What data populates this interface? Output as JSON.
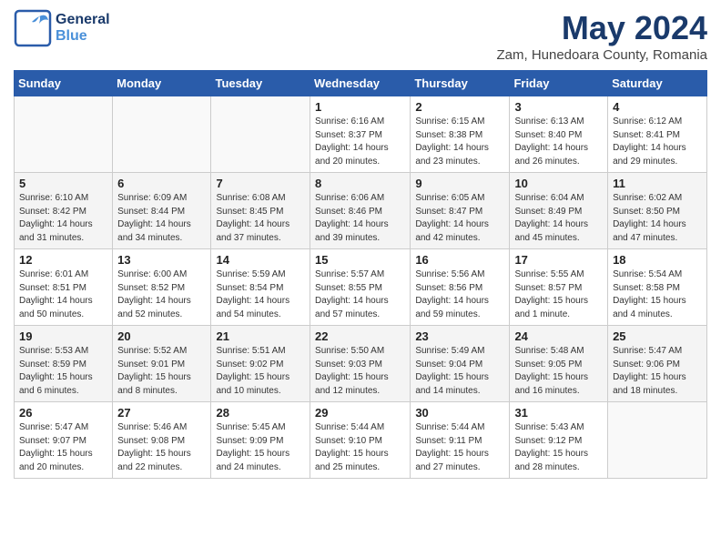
{
  "header": {
    "logo_line1": "General",
    "logo_line2": "Blue",
    "title": "May 2024",
    "subtitle": "Zam, Hunedoara County, Romania"
  },
  "weekdays": [
    "Sunday",
    "Monday",
    "Tuesday",
    "Wednesday",
    "Thursday",
    "Friday",
    "Saturday"
  ],
  "weeks": [
    [
      {
        "day": "",
        "info": ""
      },
      {
        "day": "",
        "info": ""
      },
      {
        "day": "",
        "info": ""
      },
      {
        "day": "1",
        "info": "Sunrise: 6:16 AM\nSunset: 8:37 PM\nDaylight: 14 hours\nand 20 minutes."
      },
      {
        "day": "2",
        "info": "Sunrise: 6:15 AM\nSunset: 8:38 PM\nDaylight: 14 hours\nand 23 minutes."
      },
      {
        "day": "3",
        "info": "Sunrise: 6:13 AM\nSunset: 8:40 PM\nDaylight: 14 hours\nand 26 minutes."
      },
      {
        "day": "4",
        "info": "Sunrise: 6:12 AM\nSunset: 8:41 PM\nDaylight: 14 hours\nand 29 minutes."
      }
    ],
    [
      {
        "day": "5",
        "info": "Sunrise: 6:10 AM\nSunset: 8:42 PM\nDaylight: 14 hours\nand 31 minutes."
      },
      {
        "day": "6",
        "info": "Sunrise: 6:09 AM\nSunset: 8:44 PM\nDaylight: 14 hours\nand 34 minutes."
      },
      {
        "day": "7",
        "info": "Sunrise: 6:08 AM\nSunset: 8:45 PM\nDaylight: 14 hours\nand 37 minutes."
      },
      {
        "day": "8",
        "info": "Sunrise: 6:06 AM\nSunset: 8:46 PM\nDaylight: 14 hours\nand 39 minutes."
      },
      {
        "day": "9",
        "info": "Sunrise: 6:05 AM\nSunset: 8:47 PM\nDaylight: 14 hours\nand 42 minutes."
      },
      {
        "day": "10",
        "info": "Sunrise: 6:04 AM\nSunset: 8:49 PM\nDaylight: 14 hours\nand 45 minutes."
      },
      {
        "day": "11",
        "info": "Sunrise: 6:02 AM\nSunset: 8:50 PM\nDaylight: 14 hours\nand 47 minutes."
      }
    ],
    [
      {
        "day": "12",
        "info": "Sunrise: 6:01 AM\nSunset: 8:51 PM\nDaylight: 14 hours\nand 50 minutes."
      },
      {
        "day": "13",
        "info": "Sunrise: 6:00 AM\nSunset: 8:52 PM\nDaylight: 14 hours\nand 52 minutes."
      },
      {
        "day": "14",
        "info": "Sunrise: 5:59 AM\nSunset: 8:54 PM\nDaylight: 14 hours\nand 54 minutes."
      },
      {
        "day": "15",
        "info": "Sunrise: 5:57 AM\nSunset: 8:55 PM\nDaylight: 14 hours\nand 57 minutes."
      },
      {
        "day": "16",
        "info": "Sunrise: 5:56 AM\nSunset: 8:56 PM\nDaylight: 14 hours\nand 59 minutes."
      },
      {
        "day": "17",
        "info": "Sunrise: 5:55 AM\nSunset: 8:57 PM\nDaylight: 15 hours\nand 1 minute."
      },
      {
        "day": "18",
        "info": "Sunrise: 5:54 AM\nSunset: 8:58 PM\nDaylight: 15 hours\nand 4 minutes."
      }
    ],
    [
      {
        "day": "19",
        "info": "Sunrise: 5:53 AM\nSunset: 8:59 PM\nDaylight: 15 hours\nand 6 minutes."
      },
      {
        "day": "20",
        "info": "Sunrise: 5:52 AM\nSunset: 9:01 PM\nDaylight: 15 hours\nand 8 minutes."
      },
      {
        "day": "21",
        "info": "Sunrise: 5:51 AM\nSunset: 9:02 PM\nDaylight: 15 hours\nand 10 minutes."
      },
      {
        "day": "22",
        "info": "Sunrise: 5:50 AM\nSunset: 9:03 PM\nDaylight: 15 hours\nand 12 minutes."
      },
      {
        "day": "23",
        "info": "Sunrise: 5:49 AM\nSunset: 9:04 PM\nDaylight: 15 hours\nand 14 minutes."
      },
      {
        "day": "24",
        "info": "Sunrise: 5:48 AM\nSunset: 9:05 PM\nDaylight: 15 hours\nand 16 minutes."
      },
      {
        "day": "25",
        "info": "Sunrise: 5:47 AM\nSunset: 9:06 PM\nDaylight: 15 hours\nand 18 minutes."
      }
    ],
    [
      {
        "day": "26",
        "info": "Sunrise: 5:47 AM\nSunset: 9:07 PM\nDaylight: 15 hours\nand 20 minutes."
      },
      {
        "day": "27",
        "info": "Sunrise: 5:46 AM\nSunset: 9:08 PM\nDaylight: 15 hours\nand 22 minutes."
      },
      {
        "day": "28",
        "info": "Sunrise: 5:45 AM\nSunset: 9:09 PM\nDaylight: 15 hours\nand 24 minutes."
      },
      {
        "day": "29",
        "info": "Sunrise: 5:44 AM\nSunset: 9:10 PM\nDaylight: 15 hours\nand 25 minutes."
      },
      {
        "day": "30",
        "info": "Sunrise: 5:44 AM\nSunset: 9:11 PM\nDaylight: 15 hours\nand 27 minutes."
      },
      {
        "day": "31",
        "info": "Sunrise: 5:43 AM\nSunset: 9:12 PM\nDaylight: 15 hours\nand 28 minutes."
      },
      {
        "day": "",
        "info": ""
      }
    ]
  ]
}
